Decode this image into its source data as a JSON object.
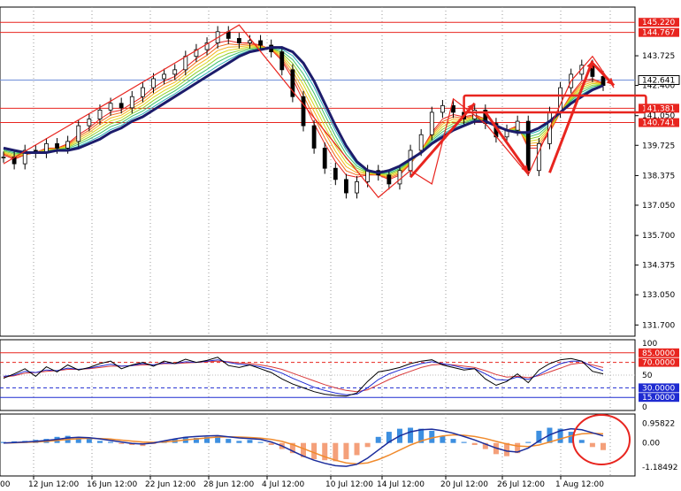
{
  "chart_data": {
    "type": "line",
    "time_labels": [
      "12 Jun 12:00",
      "16 Jun 12:00",
      "22 Jun 12:00",
      "28 Jun 12:00",
      "4 Jul 12:00",
      "10 Jul 12:00",
      "14 Jul 12:00",
      "20 Jul 12:00",
      "26 Jul 12:00",
      "1 Aug 12:00"
    ],
    "edge_time_label": "00",
    "main": {
      "ylim": [
        131.2,
        145.9
      ],
      "yticks": [
        "143.725",
        "142.400",
        "141.050",
        "139.725",
        "138.375",
        "137.050",
        "135.700",
        "134.375",
        "133.050",
        "131.700"
      ],
      "price": [
        139.2,
        138.9,
        139.5,
        139.4,
        139.8,
        139.6,
        139.9,
        140.6,
        140.9,
        141.3,
        141.6,
        141.4,
        141.9,
        142.3,
        142.7,
        142.9,
        143.1,
        143.7,
        144.0,
        144.3,
        144.8,
        144.5,
        144.3,
        144.4,
        144.2,
        143.9,
        143.1,
        141.9,
        140.6,
        139.6,
        138.7,
        138.2,
        137.6,
        138.1,
        138.6,
        138.4,
        138.0,
        138.6,
        139.5,
        140.2,
        141.2,
        141.5,
        141.2,
        140.9,
        141.3,
        140.7,
        140.1,
        140.4,
        140.8,
        138.6,
        139.8,
        141.2,
        142.3,
        142.9,
        143.3,
        142.8,
        142.4
      ],
      "ma_fast": [
        139.3,
        139.1,
        139.3,
        139.4,
        139.6,
        139.6,
        139.8,
        140.2,
        140.5,
        140.9,
        141.2,
        141.3,
        141.6,
        141.9,
        142.3,
        142.6,
        142.8,
        143.2,
        143.6,
        143.9,
        144.3,
        144.4,
        144.3,
        144.3,
        144.2,
        144.0,
        143.5,
        142.7,
        141.7,
        140.7,
        139.8,
        139.0,
        138.4,
        138.3,
        138.4,
        138.4,
        138.2,
        138.4,
        138.9,
        139.5,
        140.3,
        140.9,
        141.1,
        141.0,
        141.1,
        140.9,
        140.5,
        140.4,
        140.6,
        139.6,
        139.6,
        140.3,
        141.2,
        142.0,
        142.6,
        142.7,
        142.5
      ],
      "ma_slow": [
        139.6,
        139.5,
        139.4,
        139.4,
        139.4,
        139.5,
        139.5,
        139.6,
        139.8,
        140.0,
        140.3,
        140.5,
        140.8,
        141.0,
        141.3,
        141.6,
        141.9,
        142.2,
        142.5,
        142.8,
        143.1,
        143.4,
        143.7,
        143.9,
        144.0,
        144.1,
        144.1,
        143.9,
        143.4,
        142.6,
        141.6,
        140.6,
        139.7,
        139.0,
        138.6,
        138.5,
        138.6,
        138.8,
        139.1,
        139.4,
        139.8,
        140.1,
        140.4,
        140.6,
        140.8,
        140.8,
        140.6,
        140.4,
        140.3,
        140.3,
        140.5,
        140.8,
        141.2,
        141.6,
        141.9,
        142.2,
        142.4
      ],
      "hlines": [
        {
          "value": 145.22,
          "label": "145.220",
          "color": "#e8251f"
        },
        {
          "value": 144.767,
          "label": "144.767",
          "color": "#e8251f"
        },
        {
          "value": 141.381,
          "label": "141.381",
          "color": "#e8251f"
        },
        {
          "value": 140.741,
          "label": "140.741",
          "color": "#e8251f"
        },
        {
          "value": 142.641,
          "label": "142.641",
          "color": "#6f8fd8"
        }
      ],
      "current_price": "142.641",
      "zigzag": [
        [
          0,
          138.9
        ],
        [
          10,
          141.7
        ],
        [
          22,
          145.1
        ],
        [
          35,
          137.4
        ],
        [
          38,
          138.6
        ],
        [
          40,
          138.0
        ],
        [
          42,
          141.8
        ],
        [
          45,
          140.7
        ],
        [
          49,
          138.4
        ],
        [
          53,
          142.6
        ],
        [
          55,
          143.7
        ],
        [
          57,
          142.3
        ]
      ],
      "arrows": [
        [
          [
            38,
            138.3
          ],
          [
            44,
            141.6
          ]
        ],
        [
          [
            45,
            141.2
          ],
          [
            49,
            138.5
          ]
        ],
        [
          [
            51,
            138.5
          ],
          [
            55,
            143.5
          ]
        ],
        [
          [
            55,
            143.4
          ],
          [
            57,
            142.4
          ]
        ]
      ],
      "box": {
        "x0": 43,
        "x1": 60,
        "y0": 141.2,
        "y1": 141.95
      }
    },
    "rsi": {
      "ylim": [
        0,
        100
      ],
      "yticks": [
        "100",
        "85.0000",
        "70.0000",
        "50",
        "30.0000",
        "15.0000",
        "0"
      ],
      "levels": [
        85,
        70,
        30,
        15
      ],
      "values": [
        45,
        52,
        60,
        48,
        63,
        55,
        66,
        58,
        62,
        68,
        72,
        60,
        66,
        70,
        64,
        72,
        68,
        75,
        70,
        73,
        78,
        65,
        62,
        66,
        60,
        54,
        44,
        36,
        30,
        24,
        20,
        18,
        17,
        22,
        40,
        55,
        58,
        62,
        68,
        72,
        74,
        66,
        62,
        58,
        60,
        44,
        34,
        40,
        52,
        38,
        58,
        68,
        74,
        76,
        72,
        56,
        52
      ],
      "signal": [
        48,
        50,
        56,
        54,
        58,
        57,
        61,
        59,
        61,
        64,
        67,
        64,
        65,
        68,
        66,
        69,
        68,
        71,
        70,
        72,
        74,
        70,
        67,
        66,
        63,
        59,
        53,
        45,
        38,
        31,
        26,
        22,
        19,
        20,
        30,
        43,
        52,
        58,
        63,
        68,
        71,
        68,
        65,
        61,
        60,
        52,
        43,
        42,
        47,
        43,
        51,
        60,
        68,
        72,
        72,
        63,
        57
      ],
      "signal2": [
        47,
        49,
        53,
        54,
        56,
        57,
        59,
        59,
        60,
        62,
        64,
        64,
        65,
        66,
        66,
        68,
        68,
        69,
        70,
        71,
        72,
        71,
        69,
        68,
        66,
        63,
        59,
        53,
        47,
        41,
        35,
        30,
        26,
        24,
        27,
        35,
        43,
        50,
        56,
        62,
        66,
        67,
        66,
        64,
        62,
        57,
        51,
        47,
        48,
        46,
        49,
        55,
        61,
        67,
        69,
        66,
        62
      ]
    },
    "macd": {
      "ylim": [
        -1.45,
        1.25
      ],
      "yticks": [
        "0.95822",
        "0.00",
        "-1.18492"
      ],
      "histogram": [
        0.05,
        0.08,
        0.1,
        0.15,
        0.2,
        0.3,
        0.35,
        0.25,
        0.2,
        0.1,
        0.05,
        -0.05,
        -0.1,
        -0.15,
        -0.05,
        0.1,
        0.2,
        0.3,
        0.25,
        0.3,
        0.35,
        0.2,
        0.1,
        0.15,
        0.05,
        -0.1,
        -0.3,
        -0.5,
        -0.7,
        -0.8,
        -0.85,
        -0.9,
        -0.8,
        -0.6,
        -0.2,
        0.3,
        0.55,
        0.7,
        0.75,
        0.7,
        0.6,
        0.35,
        0.2,
        0.05,
        -0.1,
        -0.3,
        -0.55,
        -0.65,
        -0.5,
        0.05,
        0.6,
        0.75,
        0.7,
        0.55,
        0.15,
        -0.2,
        -0.35
      ],
      "main": [
        0.0,
        0.02,
        0.05,
        0.08,
        0.12,
        0.18,
        0.25,
        0.28,
        0.26,
        0.2,
        0.12,
        0.05,
        -0.02,
        -0.05,
        0.0,
        0.1,
        0.2,
        0.28,
        0.32,
        0.35,
        0.36,
        0.3,
        0.25,
        0.22,
        0.18,
        0.05,
        -0.15,
        -0.4,
        -0.65,
        -0.85,
        -1.0,
        -1.12,
        -1.15,
        -1.05,
        -0.75,
        -0.35,
        0.05,
        0.35,
        0.55,
        0.65,
        0.68,
        0.6,
        0.48,
        0.32,
        0.15,
        -0.05,
        -0.25,
        -0.4,
        -0.45,
        -0.25,
        0.1,
        0.4,
        0.6,
        0.7,
        0.65,
        0.5,
        0.35
      ],
      "signal": [
        0.0,
        0.01,
        0.03,
        0.05,
        0.08,
        0.12,
        0.17,
        0.21,
        0.23,
        0.22,
        0.19,
        0.14,
        0.09,
        0.05,
        0.03,
        0.05,
        0.09,
        0.15,
        0.2,
        0.25,
        0.29,
        0.3,
        0.29,
        0.27,
        0.24,
        0.18,
        0.08,
        -0.08,
        -0.28,
        -0.48,
        -0.68,
        -0.85,
        -0.98,
        -1.03,
        -0.98,
        -0.82,
        -0.6,
        -0.35,
        -0.1,
        0.1,
        0.25,
        0.35,
        0.4,
        0.38,
        0.32,
        0.22,
        0.08,
        -0.05,
        -0.15,
        -0.18,
        -0.1,
        0.05,
        0.2,
        0.35,
        0.45,
        0.48,
        0.45
      ]
    },
    "colors": {
      "hline": "#e8251f",
      "price_line": "#6f8fd8",
      "zigzag": "#e8251f",
      "slow_ma": "#1c1c6b",
      "rsi_main": "#000000",
      "rsi_signal": "#1f2bd1",
      "rsi_signal2": "#d93a3a",
      "rsi_upper": "#e8251f",
      "rsi_lower": "#1f2bd1",
      "macd_pos": "#3d8fe0",
      "macd_neg": "#f4a07a",
      "macd_main": "#1c2d9c",
      "macd_signal": "#f08a2c",
      "ribbon": [
        "#e8251f",
        "#f06a1c",
        "#f3b21c",
        "#d8d81c",
        "#8ecf2a",
        "#3cbf6a",
        "#2ab0b8",
        "#3a7ed8"
      ]
    }
  }
}
